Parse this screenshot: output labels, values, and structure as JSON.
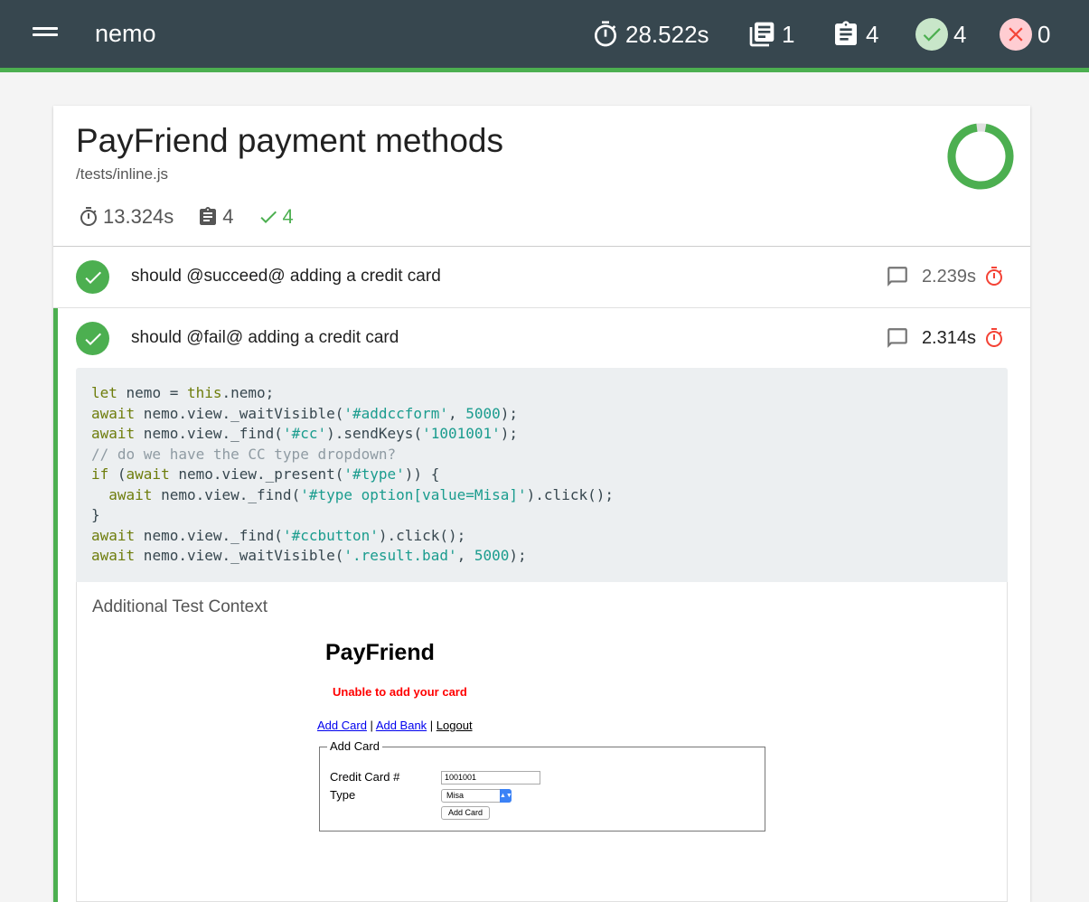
{
  "navbar": {
    "title": "nemo",
    "duration": "28.522s",
    "suites": "1",
    "tests": "4",
    "passes": "4",
    "failures": "0"
  },
  "suite": {
    "title": "PayFriend payment methods",
    "file": "/tests/inline.js",
    "duration": "13.324s",
    "tests": "4",
    "passes": "4",
    "pass_percent": 100
  },
  "tests": [
    {
      "title": "should @succeed@ adding a credit card",
      "duration": "2.239s"
    },
    {
      "title": "should @fail@ adding a credit card",
      "duration": "2.314s"
    }
  ],
  "code_lines": [
    "let nemo = this.nemo;",
    "await nemo.view._waitVisible('#addccform', 5000);",
    "await nemo.view._find('#cc').sendKeys('1001001');",
    "// do we have the CC type dropdown?",
    "if (await nemo.view._present('#type')) {",
    "  await nemo.view._find('#type option[value=Misa]').click();",
    "}",
    "await nemo.view._find('#ccbutton').click();",
    "await nemo.view._waitVisible('.result.bad', 5000);"
  ],
  "context": {
    "label": "Additional Test Context",
    "screenshot": {
      "title": "PayFriend",
      "error": "Unable to add your card",
      "links": [
        "Add Card",
        "Add Bank",
        "Logout"
      ],
      "fieldset_legend": "Add Card",
      "cc_label": "Credit Card #",
      "cc_value": "1001001",
      "type_label": "Type",
      "type_value": "Misa",
      "button_label": "Add Card"
    }
  },
  "colors": {
    "navbar": "#37474f",
    "accent": "#4caf50",
    "fail": "#f44336"
  }
}
